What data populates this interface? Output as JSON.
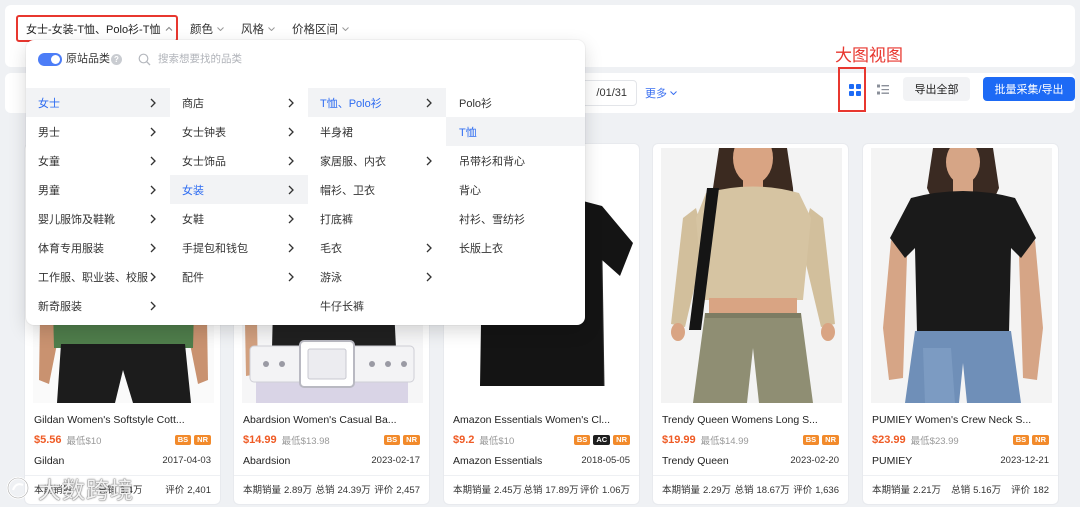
{
  "filter_bar": {
    "category_chip": "女士-女装-T恤、Polo衫-T恤",
    "color_filter": "颜色",
    "style_filter": "风格",
    "price_filter": "价格区间"
  },
  "toolbar": {
    "date_range_end": "/01/31",
    "more": "更多",
    "export_all": "导出全部",
    "batch_collect_export": "批量采集/导出"
  },
  "annotation": {
    "text": "大图视图"
  },
  "category_dropdown": {
    "source_category_label": "原站品类",
    "source_category_enabled": true,
    "help_icon": "?",
    "search_placeholder": "搜索想要找的品类",
    "columns": [
      {
        "items": [
          {
            "label": "女士",
            "has_children": true,
            "selected": true
          },
          {
            "label": "男士",
            "has_children": true,
            "selected": false
          },
          {
            "label": "女童",
            "has_children": true,
            "selected": false
          },
          {
            "label": "男童",
            "has_children": true,
            "selected": false
          },
          {
            "label": "婴儿服饰及鞋靴",
            "has_children": true,
            "selected": false
          },
          {
            "label": "体育专用服装",
            "has_children": true,
            "selected": false
          },
          {
            "label": "工作服、职业装、校服",
            "has_children": true,
            "selected": false
          },
          {
            "label": "新奇服装",
            "has_children": true,
            "selected": false
          }
        ]
      },
      {
        "items": [
          {
            "label": "商店",
            "has_children": true,
            "selected": false
          },
          {
            "label": "女士钟表",
            "has_children": true,
            "selected": false
          },
          {
            "label": "女士饰品",
            "has_children": true,
            "selected": false
          },
          {
            "label": "女装",
            "has_children": true,
            "selected": true
          },
          {
            "label": "女鞋",
            "has_children": true,
            "selected": false
          },
          {
            "label": "手提包和钱包",
            "has_children": true,
            "selected": false
          },
          {
            "label": "配件",
            "has_children": true,
            "selected": false
          }
        ]
      },
      {
        "items": [
          {
            "label": "T恤、Polo衫",
            "has_children": true,
            "selected": true
          },
          {
            "label": "半身裙",
            "has_children": false,
            "selected": false
          },
          {
            "label": "家居服、内衣",
            "has_children": true,
            "selected": false
          },
          {
            "label": "帽衫、卫衣",
            "has_children": false,
            "selected": false
          },
          {
            "label": "打底裤",
            "has_children": false,
            "selected": false
          },
          {
            "label": "毛衣",
            "has_children": true,
            "selected": false
          },
          {
            "label": "游泳",
            "has_children": true,
            "selected": false
          },
          {
            "label": "牛仔长裤",
            "has_children": false,
            "selected": false
          }
        ]
      },
      {
        "items": [
          {
            "label": "Polo衫",
            "has_children": false,
            "selected": false
          },
          {
            "label": "T恤",
            "has_children": false,
            "selected": true
          },
          {
            "label": "吊带衫和背心",
            "has_children": false,
            "selected": false
          },
          {
            "label": "背心",
            "has_children": false,
            "selected": false
          },
          {
            "label": "衬衫、雪纺衫",
            "has_children": false,
            "selected": false
          },
          {
            "label": "长版上衣",
            "has_children": false,
            "selected": false
          }
        ]
      }
    ]
  },
  "product_card_labels": {
    "period_sales": "本期销量",
    "total_sales": "总销",
    "reviews": "评价"
  },
  "products": [
    {
      "title": "Gildan Women's Softstyle Cott...",
      "price": "$5.56",
      "min_price": "最低$10",
      "badges": [
        "BS",
        "NR"
      ],
      "brand": "Gildan",
      "date": "2017-04-03",
      "period_sales": "",
      "total_sales": "3.4万",
      "reviews": "2,401"
    },
    {
      "title": "Abardsion Women's Casual Ba...",
      "price": "$14.99",
      "min_price": "最低$13.98",
      "badges": [
        "BS",
        "NR"
      ],
      "brand": "Abardsion",
      "date": "2023-02-17",
      "period_sales": "2.89万",
      "total_sales": "24.39万",
      "reviews": "2,457"
    },
    {
      "title": "Amazon Essentials Women's Cl...",
      "price": "$9.2",
      "min_price": "最低$10",
      "badges": [
        "BS",
        "AC",
        "NR"
      ],
      "brand": "Amazon Essentials",
      "date": "2018-05-05",
      "period_sales": "2.45万",
      "total_sales": "17.89万",
      "reviews": "1.06万"
    },
    {
      "title": "Trendy Queen Womens Long S...",
      "price": "$19.99",
      "min_price": "最低$14.99",
      "badges": [
        "BS",
        "NR"
      ],
      "brand": "Trendy Queen",
      "date": "2023-02-20",
      "period_sales": "2.29万",
      "total_sales": "18.67万",
      "reviews": "1,636"
    },
    {
      "title": "PUMIEY Women's Crew Neck S...",
      "price": "$23.99",
      "min_price": "最低$23.99",
      "badges": [
        "BS",
        "NR"
      ],
      "brand": "PUMIEY",
      "date": "2023-12-21",
      "period_sales": "2.21万",
      "total_sales": "5.16万",
      "reviews": "182"
    }
  ],
  "watermark": {
    "text": "大数跨境"
  },
  "colors": {
    "primary": "#1d6af5",
    "link": "#3a6ff0",
    "selected_text": "#2e6cf1",
    "price": "#ef5b25",
    "annotation": "#e8372f"
  },
  "badge_colors": {
    "BS": "#f28a2b",
    "NR": "#f28a2b",
    "AC": "#1e1e1e"
  }
}
